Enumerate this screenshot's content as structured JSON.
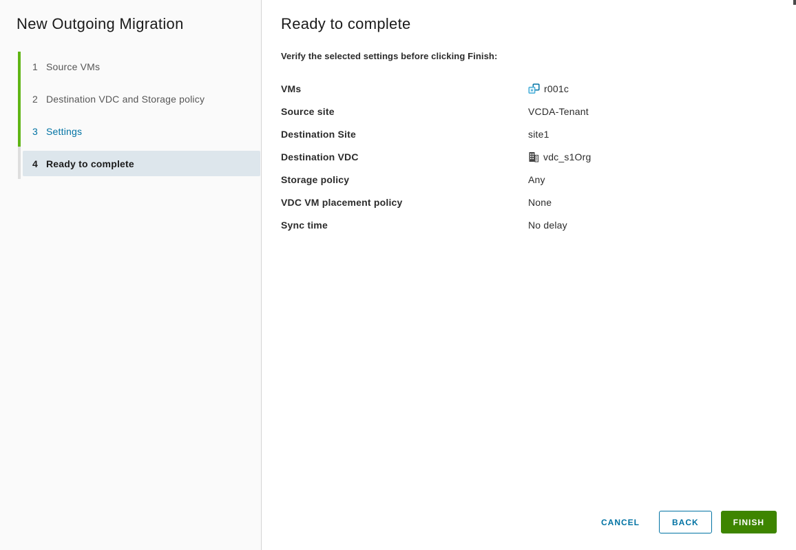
{
  "sidebar": {
    "title": "New Outgoing Migration",
    "steps": [
      {
        "number": "1",
        "label": "Source VMs",
        "state": "completed"
      },
      {
        "number": "2",
        "label": "Destination VDC and Storage policy",
        "state": "completed"
      },
      {
        "number": "3",
        "label": "Settings",
        "state": "visited-link"
      },
      {
        "number": "4",
        "label": "Ready to complete",
        "state": "current"
      }
    ]
  },
  "main": {
    "heading": "Ready to complete",
    "instruction": "Verify the selected settings before clicking Finish:",
    "summary": {
      "rows": [
        {
          "label": "VMs",
          "value": "r001c",
          "icon": "vm-icon"
        },
        {
          "label": "Source site",
          "value": "VCDA-Tenant",
          "icon": ""
        },
        {
          "label": "Destination Site",
          "value": "site1",
          "icon": ""
        },
        {
          "label": "Destination VDC",
          "value": "vdc_s1Org",
          "icon": "building-icon"
        },
        {
          "label": "Storage policy",
          "value": "Any",
          "icon": ""
        },
        {
          "label": "VDC VM placement policy",
          "value": "None",
          "icon": ""
        },
        {
          "label": "Sync time",
          "value": "No delay",
          "icon": ""
        }
      ]
    }
  },
  "footer": {
    "cancel_label": "CANCEL",
    "back_label": "BACK",
    "finish_label": "FINISH"
  },
  "colors": {
    "accent_blue": "#0072A3",
    "progress_green": "#60B515",
    "finish_green": "#3E8500",
    "current_step_bg": "#DDE6EC",
    "sidebar_bg": "#FAFAFA",
    "vm_icon_blue_dark": "#0072A3",
    "vm_icon_blue_light": "#49AFD9",
    "building_icon_gray": "#444444"
  }
}
